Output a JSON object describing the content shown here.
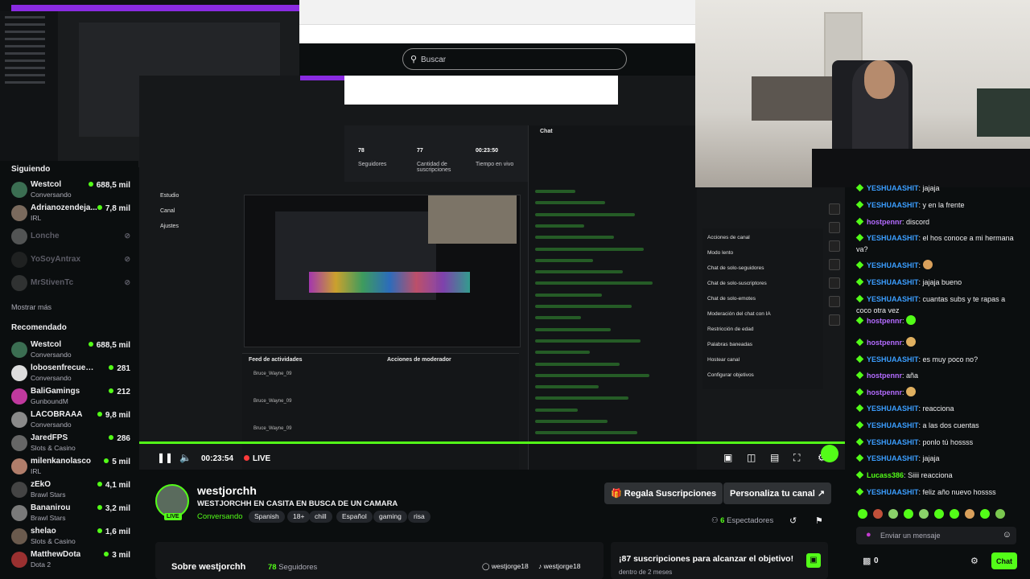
{
  "search": {
    "placeholder": "Buscar"
  },
  "sidebar": {
    "following_title": "Siguiendo",
    "following": [
      {
        "name": "Westcol",
        "game": "Conversando",
        "viewers": "688,5 mil",
        "color": "#3b6e52"
      },
      {
        "name": "Adrianozendeja...",
        "game": "IRL",
        "viewers": "7,8 mil",
        "color": "#7a6a5d"
      },
      {
        "name": "Lonche",
        "offline": true,
        "color": "#9a9a9a"
      },
      {
        "name": "YoSoyAntrax",
        "offline": true,
        "color": "#333"
      },
      {
        "name": "MrStivenTc",
        "offline": true,
        "color": "#555"
      }
    ],
    "show_more": "Mostrar más",
    "recommended_title": "Recomendado",
    "recommended": [
      {
        "name": "Westcol",
        "game": "Conversando",
        "viewers": "688,5 mil",
        "color": "#3b6e52"
      },
      {
        "name": "lobosenfrecuencia",
        "game": "Conversando",
        "viewers": "281",
        "color": "#ddd"
      },
      {
        "name": "BaliGamings",
        "game": "GunboundM",
        "viewers": "212",
        "color": "#c0399e"
      },
      {
        "name": "LACOBRAAA",
        "game": "Conversando",
        "viewers": "9,8 mil",
        "color": "#8a8a8a"
      },
      {
        "name": "JaredFPS",
        "game": "Slots & Casino",
        "viewers": "286",
        "color": "#666"
      },
      {
        "name": "milenkanolasco",
        "game": "IRL",
        "viewers": "5 mil",
        "color": "#b07d6a"
      },
      {
        "name": "zEkO",
        "game": "Brawl Stars",
        "viewers": "4,1 mil",
        "color": "#444"
      },
      {
        "name": "Bananirou",
        "game": "Brawl Stars",
        "viewers": "3,2 mil",
        "color": "#7a7a7a"
      },
      {
        "name": "shelao",
        "game": "Slots & Casino",
        "viewers": "1,6 mil",
        "color": "#6a5a4d"
      },
      {
        "name": "MatthewDota",
        "game": "Dota 2",
        "viewers": "3 mil",
        "color": "#9a3030"
      }
    ]
  },
  "player": {
    "time": "00:23:54",
    "live": "LIVE",
    "inner_stats": [
      {
        "value": "78",
        "label": "Seguidores"
      },
      {
        "value": "77",
        "label": "Cantidad de suscripciones"
      },
      {
        "value": "00:23:50",
        "label": "Tiempo en vivo"
      }
    ],
    "inner_menu": [
      "Estudio",
      "Canal",
      "Ajustes"
    ],
    "inner_feed_title": "Feed de actividades",
    "inner_mod_title": "Acciones de moderador",
    "inner_chat_title": "Chat",
    "inner_mod_items": [
      "Acciones de canal",
      "Modo lento",
      "Chat de solo-seguidores",
      "Chat de solo-suscriptores",
      "Chat de solo-emotes",
      "Moderación del chat con IA",
      "Restricción de edad",
      "Palabras baneadas",
      "Hostear canal",
      "Configurar objetivos"
    ],
    "inner_feed_items": [
      "Bruce_Wayne_09",
      "Bruce_Wayne_09",
      "Bruce_Wayne_09"
    ]
  },
  "stream": {
    "streamer": "westjorchh",
    "title": "WESTJORCHH EN CASITA EN BUSCA DE UN CAMARA",
    "category": "Conversando",
    "tags": [
      "Spanish",
      "18+",
      "chill",
      "Español",
      "gaming",
      "risa"
    ],
    "live_badge": "LIVE",
    "gift_button": "Regala Suscripciones",
    "customize_button": "Personaliza tu canal",
    "viewers_count": "6",
    "viewers_label": "Espectadores",
    "about_title": "Sobre westjorchh",
    "followers_count": "78",
    "followers_label": "Seguidores",
    "social_1": "westjorge18",
    "social_2": "westjorge18",
    "goal_title": "¡87 suscripciones para alcanzar el objetivo!",
    "goal_sub": "dentro de 2 meses"
  },
  "chat": {
    "messages": [
      {
        "user": "YESHUAASHIT",
        "color": "#3b9eff",
        "text": "jajaja"
      },
      {
        "user": "YESHUAASHIT",
        "color": "#3b9eff",
        "text": "y en la frente"
      },
      {
        "user": "hostpennr",
        "color": "#b36bff",
        "text": "discord"
      },
      {
        "user": "YESHUAASHIT",
        "color": "#3b9eff",
        "text": "el hos conoce a mi hermana va?"
      },
      {
        "user": "YESHUAASHIT",
        "color": "#3b9eff",
        "text": ""
      },
      {
        "user": "YESHUAASHIT",
        "color": "#3b9eff",
        "text": "jajaja bueno"
      },
      {
        "user": "YESHUAASHIT",
        "color": "#3b9eff",
        "text": "cuantas subs y te rapas a coco otra vez"
      },
      {
        "user": "hostpennr",
        "color": "#b36bff",
        "text": ""
      },
      {
        "user": "hostpennr",
        "color": "#b36bff",
        "text": ""
      },
      {
        "user": "YESHUAASHIT",
        "color": "#3b9eff",
        "text": "es muy poco no?"
      },
      {
        "user": "hostpennr",
        "color": "#b36bff",
        "text": "aña"
      },
      {
        "user": "hostpennr",
        "color": "#b36bff",
        "text": ""
      },
      {
        "user": "YESHUAASHIT",
        "color": "#3b9eff",
        "text": "reacciona"
      },
      {
        "user": "YESHUAASHIT",
        "color": "#3b9eff",
        "text": "a las dos cuentas"
      },
      {
        "user": "YESHUAASHIT",
        "color": "#3b9eff",
        "text": "ponlo tú hossss"
      },
      {
        "user": "YESHUAASHIT",
        "color": "#3b9eff",
        "text": "jajaja"
      },
      {
        "user": "Lucass386",
        "color": "#53fc18",
        "text": "Siiii reacciona"
      },
      {
        "user": "YESHUAASHIT",
        "color": "#3b9eff",
        "text": "feliz año nuevo hossss"
      }
    ],
    "input_placeholder": "Enviar un mensaje",
    "points": "0",
    "send_label": "Chat"
  }
}
